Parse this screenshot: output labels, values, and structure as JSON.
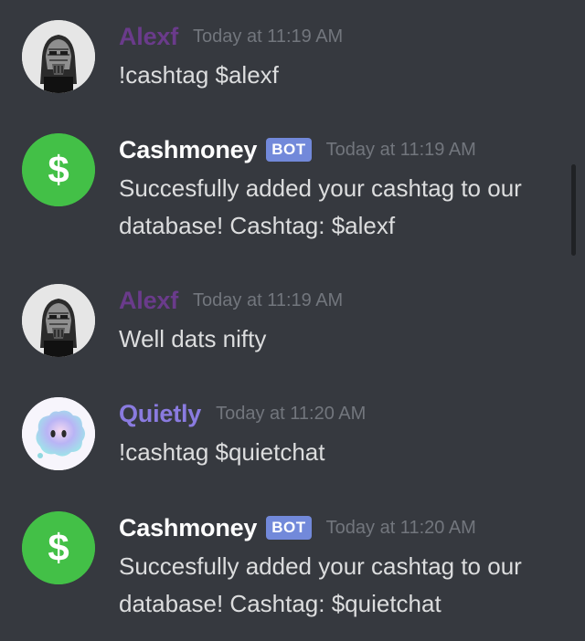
{
  "colors": {
    "background": "#36393f",
    "username_alexf": "#6a3b8b",
    "username_cashmoney": "#ffffff",
    "username_quietly": "#8a7be0",
    "bot_badge": "#7289da",
    "timestamp": "#72767d",
    "message_text": "#dcddde",
    "cash_green": "#43c047"
  },
  "messages": [
    {
      "username": "Alexf",
      "bot": "",
      "timestamp": "Today at 11:19 AM",
      "text": "!cashtag $alexf",
      "avatar_icon": "masked-face-avatar-icon"
    },
    {
      "username": "Cashmoney",
      "bot": "BOT",
      "timestamp": "Today at 11:19 AM",
      "text": "Succesfully added your cashtag to our database! Cashtag: $alexf",
      "avatar_icon": "dollar-sign-icon"
    },
    {
      "username": "Alexf",
      "bot": "",
      "timestamp": "Today at 11:19 AM",
      "text": "Well dats nifty",
      "avatar_icon": "masked-face-avatar-icon"
    },
    {
      "username": "Quietly",
      "bot": "",
      "timestamp": "Today at 11:20 AM",
      "text": "!cashtag $quietchat",
      "avatar_icon": "speech-bubble-face-icon"
    },
    {
      "username": "Cashmoney",
      "bot": "BOT",
      "timestamp": "Today at 11:20 AM",
      "text": "Succesfully added your cashtag to our database! Cashtag: $quietchat",
      "avatar_icon": "dollar-sign-icon"
    }
  ]
}
